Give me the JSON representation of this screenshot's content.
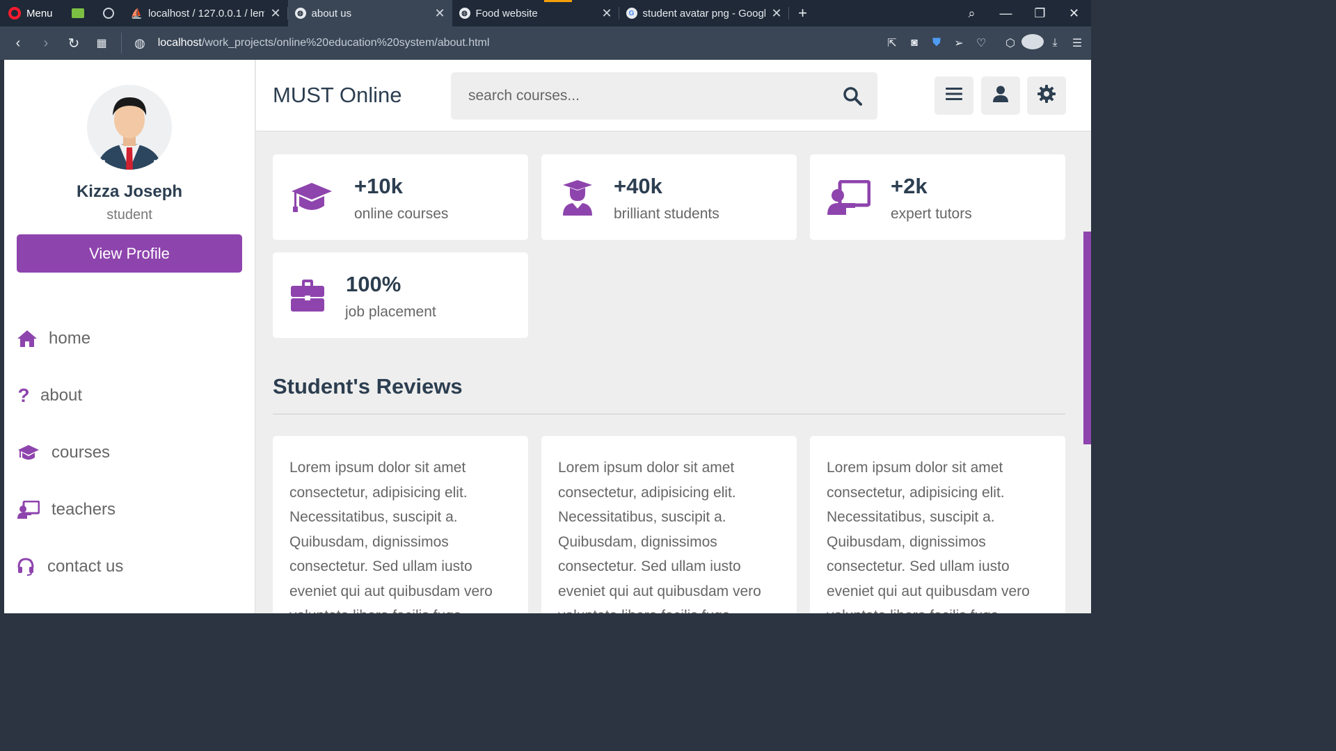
{
  "browser": {
    "menu_label": "Menu",
    "tabs": [
      {
        "title": "localhost / 127.0.0.1 / leme",
        "close": "✕"
      },
      {
        "title": "about us",
        "close": "✕"
      },
      {
        "title": "Food website",
        "close": "✕"
      },
      {
        "title": "student avatar png - Googl",
        "close": "✕"
      }
    ],
    "new_tab": "+",
    "url_host": "localhost",
    "url_path": "/work_projects/online%20education%20system/about.html"
  },
  "header": {
    "logo": "MUST Online",
    "search_placeholder": "search courses..."
  },
  "profile": {
    "name": "Kizza Joseph",
    "role": "student",
    "view_button": "View Profile"
  },
  "nav": [
    {
      "label": "home",
      "icon": "home-icon"
    },
    {
      "label": "about",
      "icon": "question-icon"
    },
    {
      "label": "courses",
      "icon": "graduation-cap-icon"
    },
    {
      "label": "teachers",
      "icon": "chalkboard-teacher-icon"
    },
    {
      "label": "contact us",
      "icon": "headset-icon"
    }
  ],
  "stats": [
    {
      "number": "+10k",
      "label": "online courses",
      "icon": "graduation-cap-icon"
    },
    {
      "number": "+40k",
      "label": "brilliant students",
      "icon": "user-graduate-icon"
    },
    {
      "number": "+2k",
      "label": "expert tutors",
      "icon": "chalkboard-teacher-icon"
    },
    {
      "number": "100%",
      "label": "job placement",
      "icon": "briefcase-icon"
    }
  ],
  "reviews": {
    "title": "Student's Reviews",
    "items": [
      {
        "text": "Lorem ipsum dolor sit amet consectetur, adipisicing elit. Necessitatibus, suscipit a. Quibusdam, dignissimos consectetur. Sed ullam iusto eveniet qui aut quibusdam vero voluptate libero facilis fuga"
      },
      {
        "text": "Lorem ipsum dolor sit amet consectetur, adipisicing elit. Necessitatibus, suscipit a. Quibusdam, dignissimos consectetur. Sed ullam iusto eveniet qui aut quibusdam vero voluptate libero facilis fuga"
      },
      {
        "text": "Lorem ipsum dolor sit amet consectetur, adipisicing elit. Necessitatibus, suscipit a. Quibusdam, dignissimos consectetur. Sed ullam iusto eveniet qui aut quibusdam vero voluptate libero facilis fuga"
      }
    ]
  },
  "colors": {
    "accent": "#8e44ad",
    "heading": "#2c3e50",
    "text": "#666666",
    "background": "#eeeeee"
  }
}
